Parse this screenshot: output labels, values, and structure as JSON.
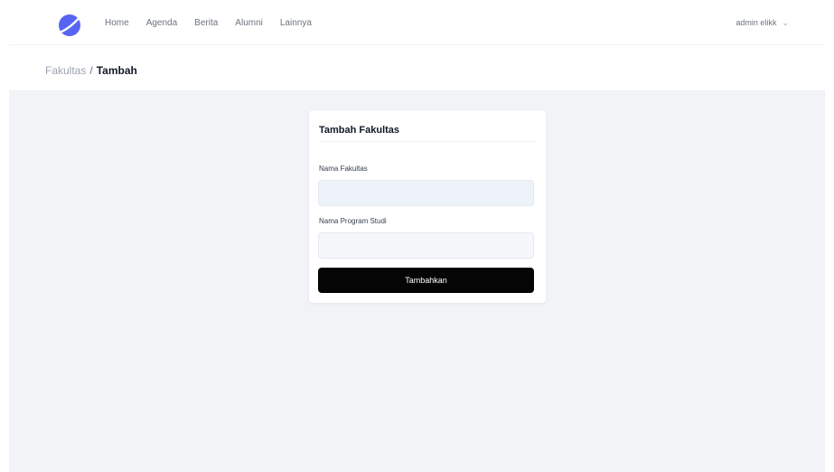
{
  "nav": {
    "links": [
      "Home",
      "Agenda",
      "Berita",
      "Alumni",
      "Lainnya"
    ],
    "user": "admin elikk"
  },
  "breadcrumb": {
    "parent": "Fakultas",
    "separator": "/",
    "current": "Tambah"
  },
  "form": {
    "title": "Tambah Fakultas",
    "field1_label": "Nama Fakultas",
    "field1_value": "",
    "field2_label": "Nama Program Studi",
    "field2_value": "",
    "submit_label": "Tambahkan"
  },
  "colors": {
    "brand": "#5865f2",
    "button": "#050505",
    "content_bg": "#f1f3f6"
  },
  "icons": {
    "logo": "brand-logo-icon",
    "dropdown": "chevron-down-icon"
  }
}
